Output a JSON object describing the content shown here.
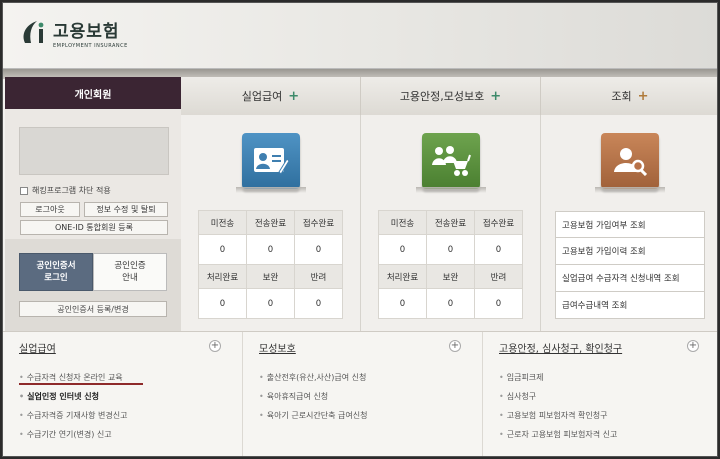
{
  "header": {
    "logo_title": "고용보험",
    "logo_subtitle": "EMPLOYMENT INSURANCE"
  },
  "left": {
    "tab": "개인회원",
    "security_checkbox": "해킹프로그램 차단 적용",
    "login_button": "로그아웃",
    "edit_button": "정보 수정 및 탈퇴",
    "oneid_button": "ONE-ID 통합회원 등록",
    "cert_login": [
      "공인인증서",
      "로그인"
    ],
    "cert_guide": [
      "공인인증",
      "안내"
    ],
    "cert_register": "공인인증서 등록/변경"
  },
  "columns": [
    {
      "title": "실업급여",
      "plus": "+"
    },
    {
      "title": "고용안정,모성보호",
      "plus": "+"
    },
    {
      "title": "조회",
      "plus": "+"
    }
  ],
  "stat_tables": [
    {
      "row1_head": [
        "미전송",
        "전송완료",
        "접수완료"
      ],
      "row1_vals": [
        "0",
        "0",
        "0"
      ],
      "row2_head": [
        "처리완료",
        "보완",
        "반려"
      ],
      "row2_vals": [
        "0",
        "0",
        "0"
      ]
    },
    {
      "row1_head": [
        "미전송",
        "전송완료",
        "접수완료"
      ],
      "row1_vals": [
        "0",
        "0",
        "0"
      ],
      "row2_head": [
        "처리완료",
        "보완",
        "반려"
      ],
      "row2_vals": [
        "0",
        "0",
        "0"
      ]
    }
  ],
  "query_items": [
    "고용보험 가입여부 조회",
    "고용보험 가입이력 조회",
    "실업급여 수급자격 신청내역 조회",
    "급여수급내역 조회"
  ],
  "bottom": {
    "col1": {
      "title": "실업급여",
      "items": [
        "수급자격 신청자 온라인 교육",
        "실업인정 인터넷 신청",
        "수급자격증 기재사항 변경신고",
        "수급기간 연기(변경) 신고"
      ]
    },
    "col2": {
      "title": "모성보호",
      "items": [
        "출산전후(유산,사산)급여 신청",
        "육아휴직급여 신청",
        "육아기 근로시간단축 급여신청"
      ]
    },
    "col3": {
      "title": "고용안정, 심사청구, 확인청구",
      "items": [
        "임금피크제",
        "심사청구",
        "고용보험 피보험자격 확인청구",
        "근로자 고용보험 피보험자격 신고"
      ]
    },
    "plus": "+"
  },
  "colors": {
    "member_tab": "#3b2533",
    "icon_blue": "#3f7fb0",
    "icon_green": "#5b8f3e",
    "icon_orange": "#b8734a"
  }
}
